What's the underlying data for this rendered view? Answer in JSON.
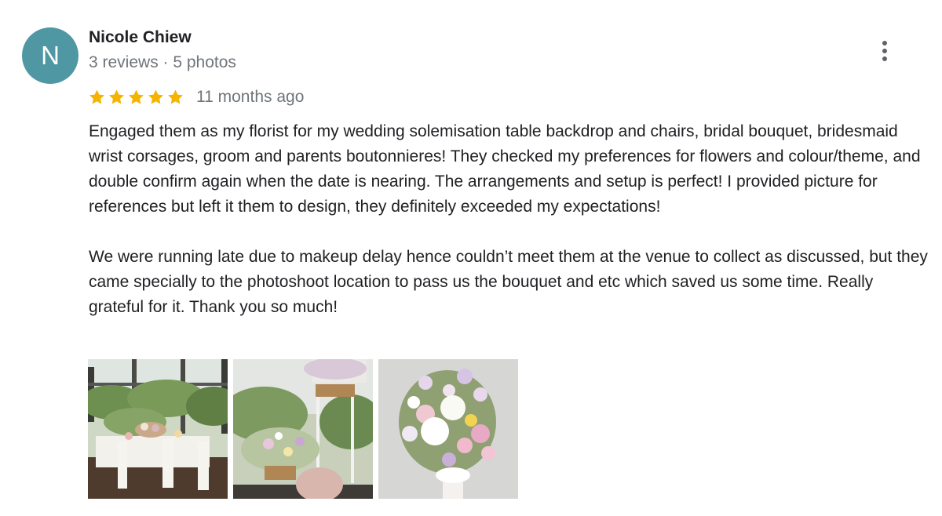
{
  "reviewer": {
    "initial": "N",
    "name": "Nicole Chiew",
    "meta": "3 reviews · 5 photos",
    "avatar_color": "#4f97a3"
  },
  "rating": {
    "stars": 5,
    "max": 5,
    "star_color": "#f4b400",
    "time": "11 months ago"
  },
  "review": {
    "paragraphs": [
      "Engaged them as my florist for my wedding solemisation table backdrop and chairs, bridal bouquet, bridesmaid wrist corsages, groom and parents boutonnieres! They checked my preferences for flowers and colour/theme, and double confirm again when the date is nearing. The arrangements and setup is perfect! I provided picture for references but left it them to design, they definitely exceeded my expectations!",
      "We were running late due to makeup delay hence couldn’t meet them at the venue to collect as discussed, but they came specially to the photoshoot location to pass us the bouquet and etc which saved us some time. Really grateful for it. Thank you so much!"
    ]
  },
  "actions": {
    "more_icon": "more-vert-icon"
  },
  "photos": [
    {
      "subject": "solemnisation-table-photo"
    },
    {
      "subject": "floral-backdrop-photo"
    },
    {
      "subject": "bridal-bouquet-photo"
    }
  ]
}
